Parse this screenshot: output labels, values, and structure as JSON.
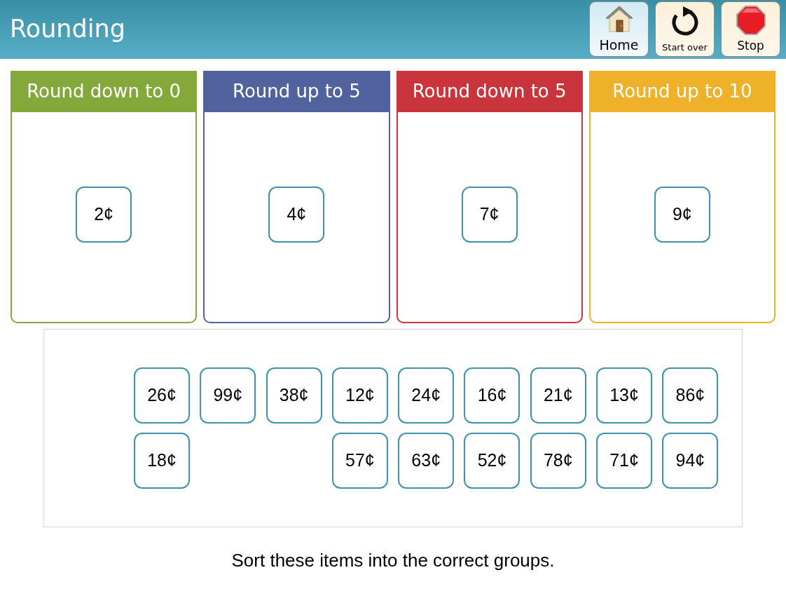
{
  "header": {
    "title": "Rounding",
    "buttons": [
      {
        "kind": "home",
        "label": "Home"
      },
      {
        "kind": "restart",
        "label": "Start over"
      },
      {
        "kind": "stop",
        "label": "Stop"
      }
    ]
  },
  "groups": [
    {
      "title": "Round down to 0",
      "color": "#84a93a",
      "items": [
        "2¢"
      ]
    },
    {
      "title": "Round up to 5",
      "color": "#52629e",
      "items": [
        "4¢"
      ]
    },
    {
      "title": "Round down to 5",
      "color": "#c9343d",
      "items": [
        "7¢"
      ]
    },
    {
      "title": "Round up to 10",
      "color": "#efb02a",
      "items": [
        "9¢"
      ]
    }
  ],
  "tray": {
    "rows": [
      [
        "26¢",
        "99¢",
        "38¢",
        "12¢",
        "24¢",
        "16¢",
        "21¢",
        "13¢",
        "86¢"
      ],
      [
        "18¢",
        "",
        "",
        "57¢",
        "63¢",
        "52¢",
        "78¢",
        "71¢",
        "94¢"
      ]
    ]
  },
  "instruction": "Sort these items into the correct groups."
}
